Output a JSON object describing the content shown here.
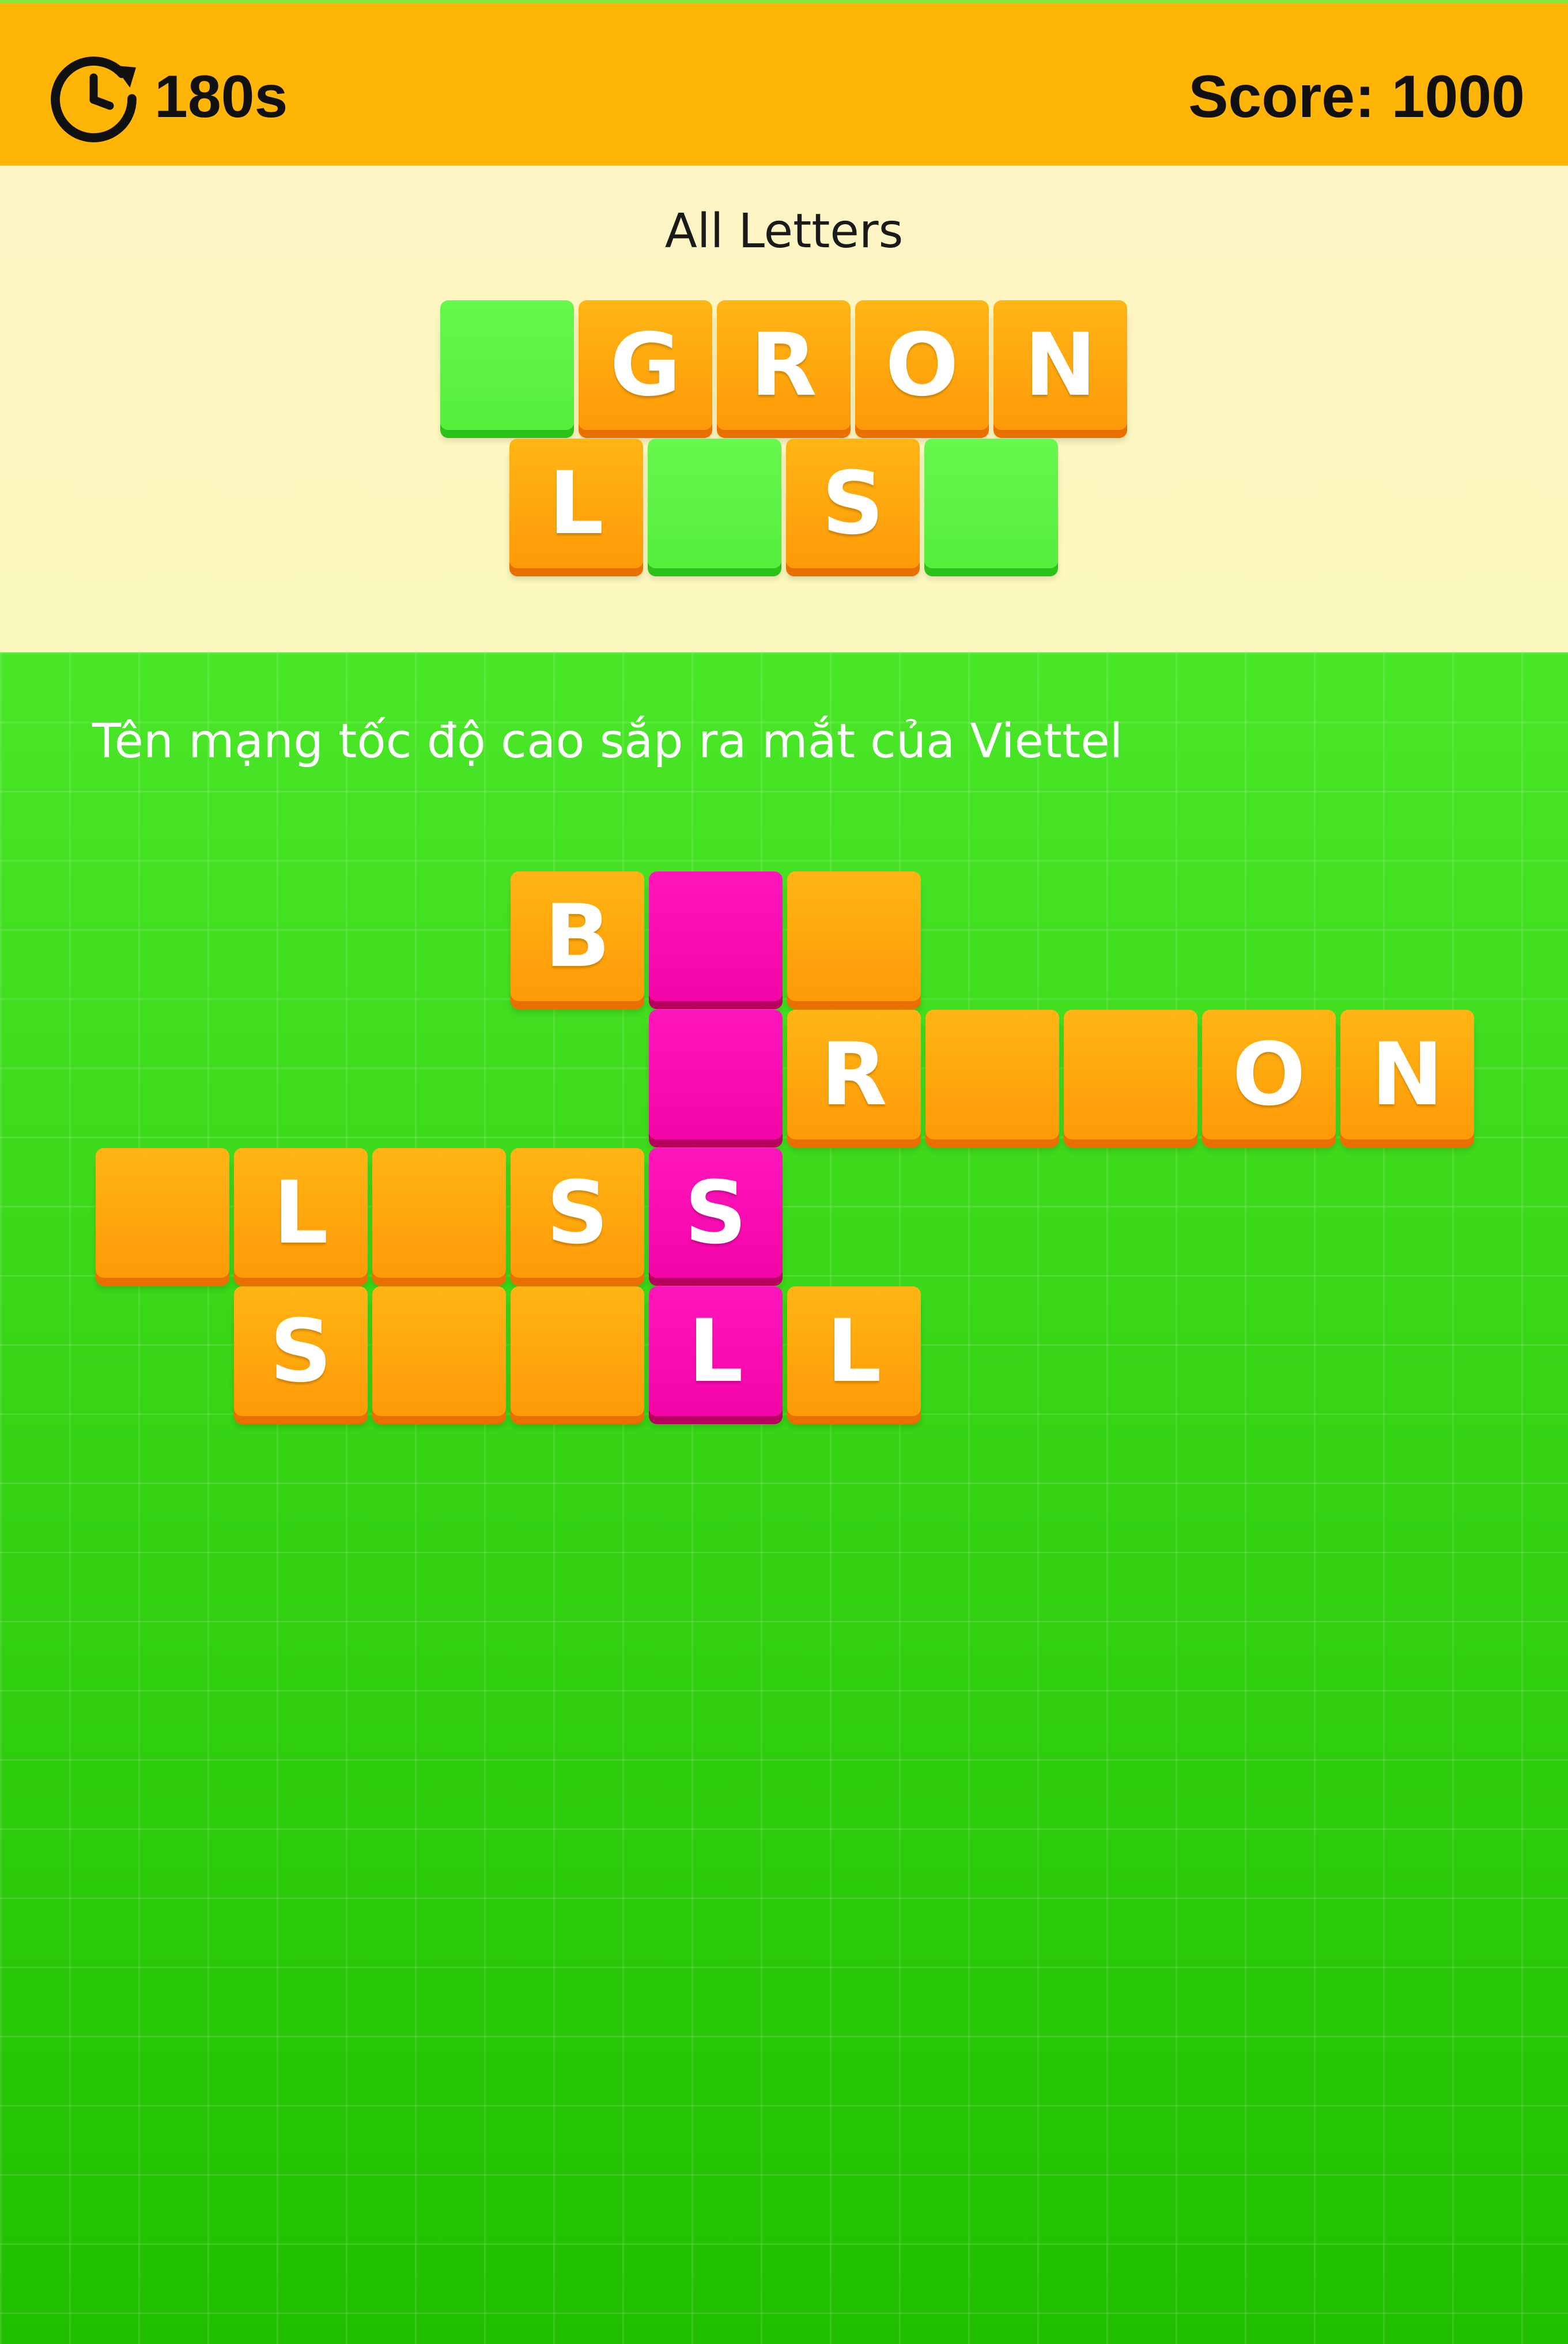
{
  "header": {
    "timer_icon": "stopwatch-icon",
    "timer_text": "180s",
    "score_text": "Score: 1000",
    "bar_color": "#ffb506"
  },
  "letters_panel": {
    "title": "All Letters",
    "rows": [
      [
        {
          "letter": "",
          "state": "green"
        },
        {
          "letter": "G",
          "state": "orange"
        },
        {
          "letter": "R",
          "state": "orange"
        },
        {
          "letter": "O",
          "state": "orange"
        },
        {
          "letter": "N",
          "state": "orange"
        }
      ],
      [
        {
          "letter": "L",
          "state": "orange"
        },
        {
          "letter": "",
          "state": "green"
        },
        {
          "letter": "S",
          "state": "orange"
        },
        {
          "letter": "",
          "state": "green"
        }
      ]
    ]
  },
  "board": {
    "clue": "Tên mạng tốc độ cao sắp ra mắt của Viettel",
    "grid_columns": 10,
    "tiles": [
      {
        "row": 0,
        "col": 3,
        "letter": "B",
        "color": "orange"
      },
      {
        "row": 0,
        "col": 4,
        "letter": "",
        "color": "pink"
      },
      {
        "row": 0,
        "col": 5,
        "letter": "",
        "color": "orange"
      },
      {
        "row": 1,
        "col": 4,
        "letter": "",
        "color": "pink"
      },
      {
        "row": 1,
        "col": 5,
        "letter": "R",
        "color": "orange"
      },
      {
        "row": 1,
        "col": 6,
        "letter": "",
        "color": "orange"
      },
      {
        "row": 1,
        "col": 7,
        "letter": "",
        "color": "orange"
      },
      {
        "row": 1,
        "col": 8,
        "letter": "O",
        "color": "orange"
      },
      {
        "row": 1,
        "col": 9,
        "letter": "N",
        "color": "orange"
      },
      {
        "row": 2,
        "col": 0,
        "letter": "",
        "color": "orange"
      },
      {
        "row": 2,
        "col": 1,
        "letter": "L",
        "color": "orange"
      },
      {
        "row": 2,
        "col": 2,
        "letter": "",
        "color": "orange"
      },
      {
        "row": 2,
        "col": 3,
        "letter": "S",
        "color": "orange"
      },
      {
        "row": 2,
        "col": 4,
        "letter": "S",
        "color": "pink"
      },
      {
        "row": 3,
        "col": 1,
        "letter": "S",
        "color": "orange"
      },
      {
        "row": 3,
        "col": 2,
        "letter": "",
        "color": "orange"
      },
      {
        "row": 3,
        "col": 3,
        "letter": "",
        "color": "orange"
      },
      {
        "row": 3,
        "col": 4,
        "letter": "L",
        "color": "pink"
      },
      {
        "row": 3,
        "col": 5,
        "letter": "L",
        "color": "orange"
      }
    ]
  },
  "colors": {
    "tile_orange": "#ff9a08",
    "tile_green": "#55ee3c",
    "tile_pink": "#f305a8",
    "board_green": "#3fdc22",
    "panel_cream": "#fbf8bd"
  }
}
